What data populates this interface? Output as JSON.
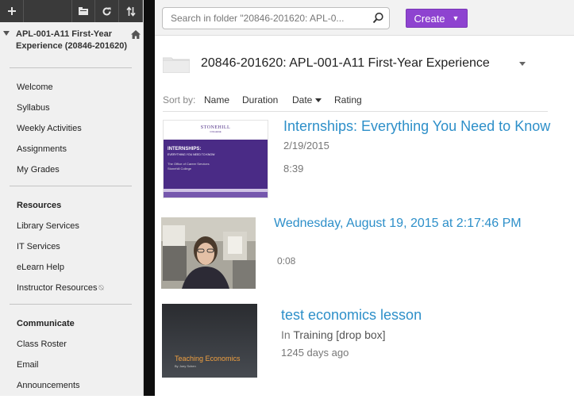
{
  "sidebar": {
    "course_title": "APL-001-A11 First-Year Experience (20846-201620)",
    "toolbar_icons": [
      "add-icon",
      "folder-view-icon",
      "refresh-icon",
      "sort-icon"
    ],
    "items": [
      {
        "label": "Welcome"
      },
      {
        "label": "Syllabus"
      },
      {
        "label": "Weekly Activities"
      },
      {
        "label": "Assignments"
      },
      {
        "label": "My Grades"
      }
    ],
    "resources_heading": "Resources",
    "resources": [
      {
        "label": "Library Services"
      },
      {
        "label": "IT Services"
      },
      {
        "label": "eLearn Help"
      },
      {
        "label": "Instructor Resources"
      }
    ],
    "communicate_heading": "Communicate",
    "communicate": [
      {
        "label": "Class Roster"
      },
      {
        "label": "Email"
      },
      {
        "label": "Announcements"
      }
    ]
  },
  "search": {
    "placeholder": "Search in folder \"20846-201620: APL-0..."
  },
  "create_label": "Create",
  "folder": {
    "title": "20846-201620: APL-001-A11 First-Year Experience"
  },
  "sort": {
    "label": "Sort by:",
    "options": [
      "Name",
      "Duration",
      "Date",
      "Rating"
    ],
    "active": "Date"
  },
  "sessions": [
    {
      "title": "Internships: Everything You Need to Know",
      "date": "2/19/2015",
      "duration": "8:39",
      "thumb": {
        "brand": "STONEHILL",
        "brand_sub": "COLLEGE",
        "heading": "INTERNSHIPS:",
        "subheading": "EVERYTHING YOU NEED TO KNOW",
        "line1": "The Office of Career Services",
        "line2": "Stonehill College"
      }
    },
    {
      "title": "Wednesday, August 19, 2015 at 2:17:46 PM",
      "duration": "0:08"
    },
    {
      "title": "test economics lesson",
      "folder_prefix": "In",
      "folder_name": "Training [drop box]",
      "age": "1245 days ago",
      "thumb": {
        "heading": "Teaching Economics",
        "byline": "By Joey Schen"
      }
    }
  ],
  "colors": {
    "accent": "#2d8fc9",
    "create_button": "#8e43d0",
    "toolbar": "#3a3a3a"
  }
}
